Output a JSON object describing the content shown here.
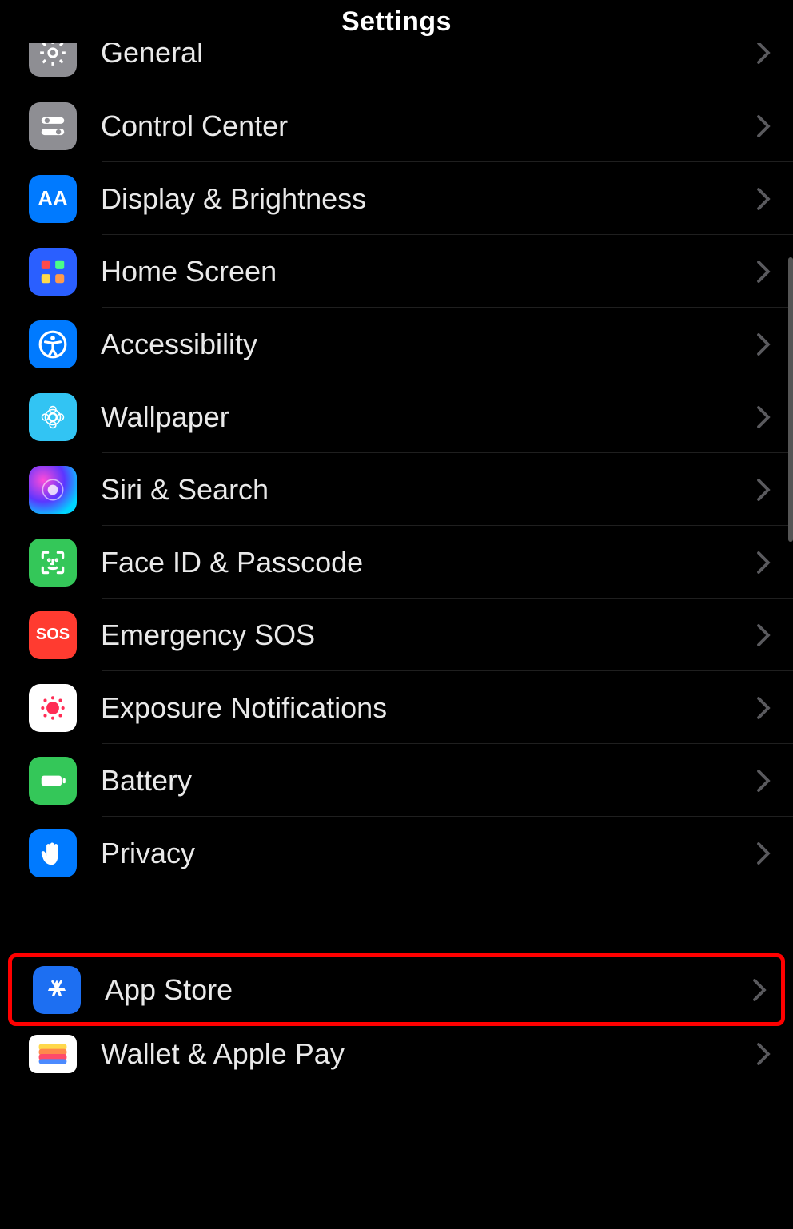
{
  "header": {
    "title": "Settings"
  },
  "rows": {
    "general": {
      "label": "General"
    },
    "control": {
      "label": "Control Center"
    },
    "display": {
      "label": "Display & Brightness"
    },
    "home": {
      "label": "Home Screen"
    },
    "access": {
      "label": "Accessibility"
    },
    "wallpaper": {
      "label": "Wallpaper"
    },
    "siri": {
      "label": "Siri & Search"
    },
    "faceid": {
      "label": "Face ID & Passcode"
    },
    "sos": {
      "label": "Emergency SOS"
    },
    "exposure": {
      "label": "Exposure Notifications"
    },
    "battery": {
      "label": "Battery"
    },
    "privacy": {
      "label": "Privacy"
    },
    "appstore": {
      "label": "App Store"
    },
    "wallet": {
      "label": "Wallet & Apple Pay"
    }
  },
  "icons": {
    "sos_text": "SOS",
    "aa_text": "AA"
  },
  "annotation": {
    "highlighted_row": "appstore"
  }
}
